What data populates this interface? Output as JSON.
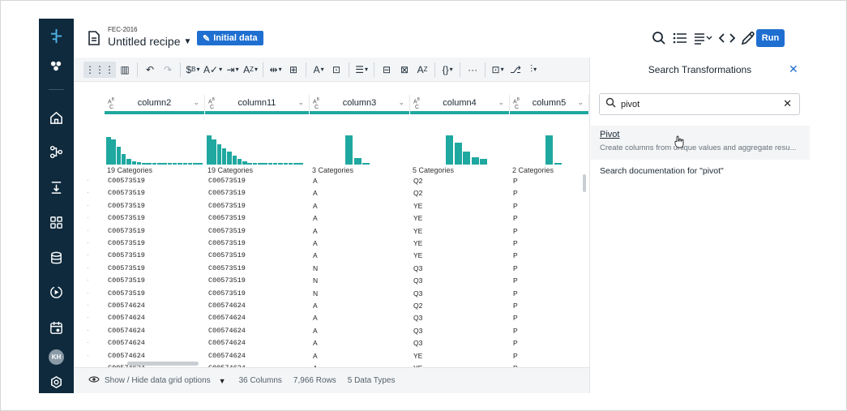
{
  "header": {
    "project": "FEC-2016",
    "recipe_title": "Untitled recipe",
    "initial_data_label": "Initial data",
    "run_label": "Run"
  },
  "nav": {
    "avatar_initials": "KH"
  },
  "columns": [
    {
      "name": "column2",
      "categories": "19 Categories",
      "hist": [
        0.95,
        0.85,
        0.6,
        0.35,
        0.2,
        0.12,
        0.08,
        0.06,
        0.05,
        0.05,
        0.05,
        0.05,
        0.05,
        0.05,
        0.05,
        0.05,
        0.05,
        0.05,
        0.05
      ]
    },
    {
      "name": "column11",
      "categories": "19 Categories",
      "hist": [
        1.0,
        0.85,
        0.7,
        0.55,
        0.45,
        0.3,
        0.2,
        0.1,
        0.05,
        0.05,
        0.05,
        0.05,
        0.05,
        0.05,
        0.05,
        0.05,
        0.05,
        0.05,
        0.05
      ]
    },
    {
      "name": "column3",
      "categories": "3 Categories",
      "hist": [
        1.0,
        0.22,
        0.06
      ]
    },
    {
      "name": "column4",
      "categories": "5 Categories",
      "hist": [
        1.0,
        0.75,
        0.45,
        0.25,
        0.2
      ]
    },
    {
      "name": "column5",
      "categories": "2 Categories",
      "hist": [
        1.0,
        0.05
      ]
    }
  ],
  "rows": [
    [
      "C00573519",
      "C00573519",
      "A",
      "Q2",
      "P"
    ],
    [
      "C00573519",
      "C00573519",
      "A",
      "Q2",
      "P"
    ],
    [
      "C00573519",
      "C00573519",
      "A",
      "YE",
      "P"
    ],
    [
      "C00573519",
      "C00573519",
      "A",
      "YE",
      "P"
    ],
    [
      "C00573519",
      "C00573519",
      "A",
      "YE",
      "P"
    ],
    [
      "C00573519",
      "C00573519",
      "A",
      "YE",
      "P"
    ],
    [
      "C00573519",
      "C00573519",
      "A",
      "YE",
      "P"
    ],
    [
      "C00573519",
      "C00573519",
      "N",
      "Q3",
      "P"
    ],
    [
      "C00573519",
      "C00573519",
      "N",
      "Q3",
      "P"
    ],
    [
      "C00573519",
      "C00573519",
      "N",
      "Q3",
      "P"
    ],
    [
      "C00574624",
      "C00574624",
      "A",
      "Q2",
      "P"
    ],
    [
      "C00574624",
      "C00574624",
      "A",
      "Q3",
      "P"
    ],
    [
      "C00574624",
      "C00574624",
      "A",
      "Q3",
      "P"
    ],
    [
      "C00574624",
      "C00574624",
      "A",
      "Q3",
      "P"
    ],
    [
      "C00574624",
      "C00574624",
      "A",
      "YE",
      "P"
    ],
    [
      "C00574624",
      "C00574624",
      "A",
      "YE",
      "P"
    ]
  ],
  "status": {
    "grid_options": "Show / Hide data grid options",
    "columns": "36 Columns",
    "rows": "7,966 Rows",
    "types": "5 Data Types"
  },
  "panel": {
    "title": "Search Transformations",
    "search_value": "pivot",
    "result_name": "Pivot",
    "result_desc": "Create columns from unique values and aggregate resu...",
    "doc_link": "Search documentation for \"pivot\""
  },
  "colors": {
    "accent": "#1f6fd1",
    "nav": "#0f2a3d",
    "teal": "#1fa8a0"
  }
}
